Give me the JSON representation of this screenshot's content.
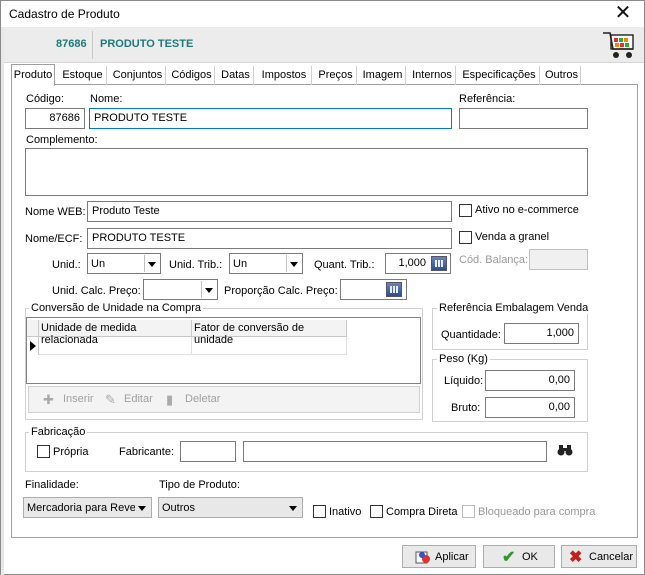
{
  "window": {
    "title": "Cadastro de Produto",
    "close": "✕"
  },
  "header": {
    "code": "87686",
    "name": "PRODUTO TESTE"
  },
  "tabs": [
    "Produto",
    "Estoque",
    "Conjuntos",
    "Códigos",
    "Datas",
    "Impostos",
    "Preços",
    "Imagem",
    "Internos",
    "Especificações",
    "Outros"
  ],
  "form": {
    "codigo_label": "Código:",
    "codigo": "87686",
    "nome_label": "Nome:",
    "nome": "PRODUTO TESTE",
    "referencia_label": "Referência:",
    "referencia": "",
    "complemento_label": "Complemento:",
    "complemento": "",
    "nome_web_label": "Nome WEB:",
    "nome_web": "Produto Teste",
    "ativo_ecommerce_label": "Ativo no e-commerce",
    "nome_ecf_label": "Nome/ECF:",
    "nome_ecf": "PRODUTO TESTE",
    "venda_granel_label": "Venda a granel",
    "unid_label": "Unid.:",
    "unid": "Un",
    "unid_trib_label": "Unid. Trib.:",
    "unid_trib": "Un",
    "quant_trib_label": "Quant. Trib.:",
    "quant_trib": "1,000",
    "cod_balanca_label": "Cód. Balança:",
    "cod_balanca": "",
    "unid_calc_preco_label": "Unid. Calc. Preço:",
    "unid_calc_preco": "",
    "proporcao_calc_preco_label": "Proporção Calc. Preço:",
    "proporcao_calc_preco": ""
  },
  "conversao": {
    "title": "Conversão de Unidade na Compra",
    "columns": [
      "Unidade de medida relacionada",
      "Fator de conversão de unidade"
    ],
    "toolbar": {
      "inserir": "Inserir",
      "editar": "Editar",
      "deletar": "Deletar"
    }
  },
  "embalagem": {
    "title": "Referência Embalagem Venda",
    "quantidade_label": "Quantidade:",
    "quantidade": "1,000"
  },
  "peso": {
    "title": "Peso (Kg)",
    "liquido_label": "Líquido:",
    "liquido": "0,00",
    "bruto_label": "Bruto:",
    "bruto": "0,00"
  },
  "fabricacao": {
    "title": "Fabricação",
    "propria_label": "Própria",
    "fabricante_label": "Fabricante:",
    "fabricante_code": "",
    "fabricante_name": ""
  },
  "bottom": {
    "finalidade_label": "Finalidade:",
    "finalidade": "Mercadoria para Reve",
    "tipo_label": "Tipo de Produto:",
    "tipo": "Outros",
    "inativo_label": "Inativo",
    "compra_direta_label": "Compra Direta",
    "bloqueado_label": "Bloqueado para compra"
  },
  "buttons": {
    "aplicar": "Aplicar",
    "ok": "OK",
    "cancelar": "Cancelar"
  },
  "colors": {
    "header_text": "#1d7a7a",
    "focus_border": "#0078d7",
    "ok_check": "#2e9a2e",
    "cancel_x": "#c42020"
  }
}
